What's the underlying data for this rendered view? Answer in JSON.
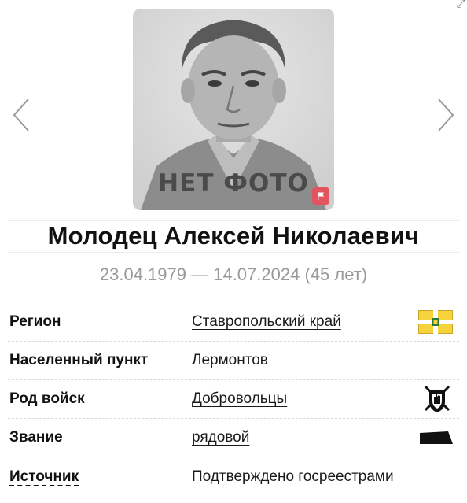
{
  "photo": {
    "placeholder_text": "НЕТ ФОТО",
    "badge_icon": "flag-icon",
    "badge_color": "#e2555f"
  },
  "carousel": {
    "prev_icon": "chevron-left-icon",
    "next_icon": "chevron-right-icon"
  },
  "person": {
    "name": "Молодец Алексей Николаевич",
    "dates": "23.04.1979 — 14.07.2024 (45 лет)"
  },
  "details": [
    {
      "label": "Регион",
      "value": "Ставропольский край",
      "is_link": true,
      "icon": "region-flag-icon"
    },
    {
      "label": "Населенный пункт",
      "value": "Лермонтов",
      "is_link": true,
      "icon": ""
    },
    {
      "label": "Род войск",
      "value": "Добровольцы",
      "is_link": true,
      "icon": "volunteers-emblem-icon"
    },
    {
      "label": "Звание",
      "value": "рядовой",
      "is_link": true,
      "icon": "rank-insignia-icon"
    },
    {
      "label": "Источник",
      "value": "Подтверждено госреестрами",
      "is_link": false,
      "icon": ""
    }
  ],
  "colors": {
    "name": "#111111",
    "dates": "#9a9a9a",
    "region_flag_yellow": "#f6d33d"
  }
}
